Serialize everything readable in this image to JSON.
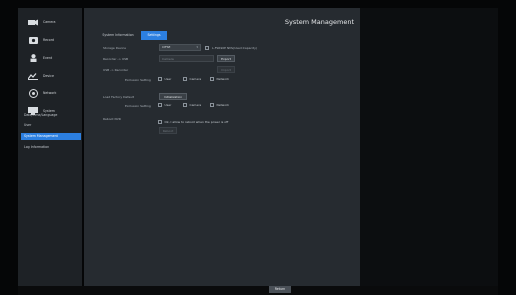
{
  "sidebar": {
    "items": [
      {
        "label": "Camera",
        "icon": "camera-icon"
      },
      {
        "label": "Record",
        "icon": "record-icon"
      },
      {
        "label": "Event",
        "icon": "event-icon"
      },
      {
        "label": "Device",
        "icon": "device-icon"
      },
      {
        "label": "Network",
        "icon": "network-icon"
      },
      {
        "label": "System",
        "icon": "system-icon"
      }
    ],
    "sub_items": [
      {
        "label": "Date/Time/Language",
        "active": false
      },
      {
        "label": "User",
        "active": false
      },
      {
        "label": "System Management",
        "active": true
      },
      {
        "label": "Log Information",
        "active": false
      }
    ]
  },
  "main": {
    "title": "System Management",
    "tabs": [
      {
        "label": "System Information",
        "active": false
      },
      {
        "label": "Settings",
        "active": true
      }
    ],
    "storage_device": {
      "label": "Storage Device",
      "value": "CIFSE",
      "checkbox_label": "L-FSR90E Ntfs(Used:Capacity)"
    },
    "recorder_to_usb": {
      "label": "Recorder -> USB",
      "input_placeholder": "Camera",
      "button": "Export"
    },
    "usb_to_recorder": {
      "label": "USB -> Recorder",
      "button": "Import"
    },
    "exclusion_setting_1": {
      "label": "Exclusion Setting",
      "options": [
        "User",
        "Camera",
        "Network"
      ]
    },
    "load_factory_default": {
      "label": "Load Factory Default",
      "button": "Initialization"
    },
    "exclusion_setting_2": {
      "label": "Exclusion Setting",
      "options": [
        "User",
        "Camera",
        "Network"
      ]
    },
    "reboot": {
      "label": "Reboot NVR",
      "option": "Ok, I allow to reboot when the power is off",
      "button": "Reboot"
    }
  },
  "footer": {
    "return_label": "Return"
  },
  "colors": {
    "accent": "#2c7fe0",
    "panel": "#262b30",
    "sidebar": "#1e2226"
  }
}
